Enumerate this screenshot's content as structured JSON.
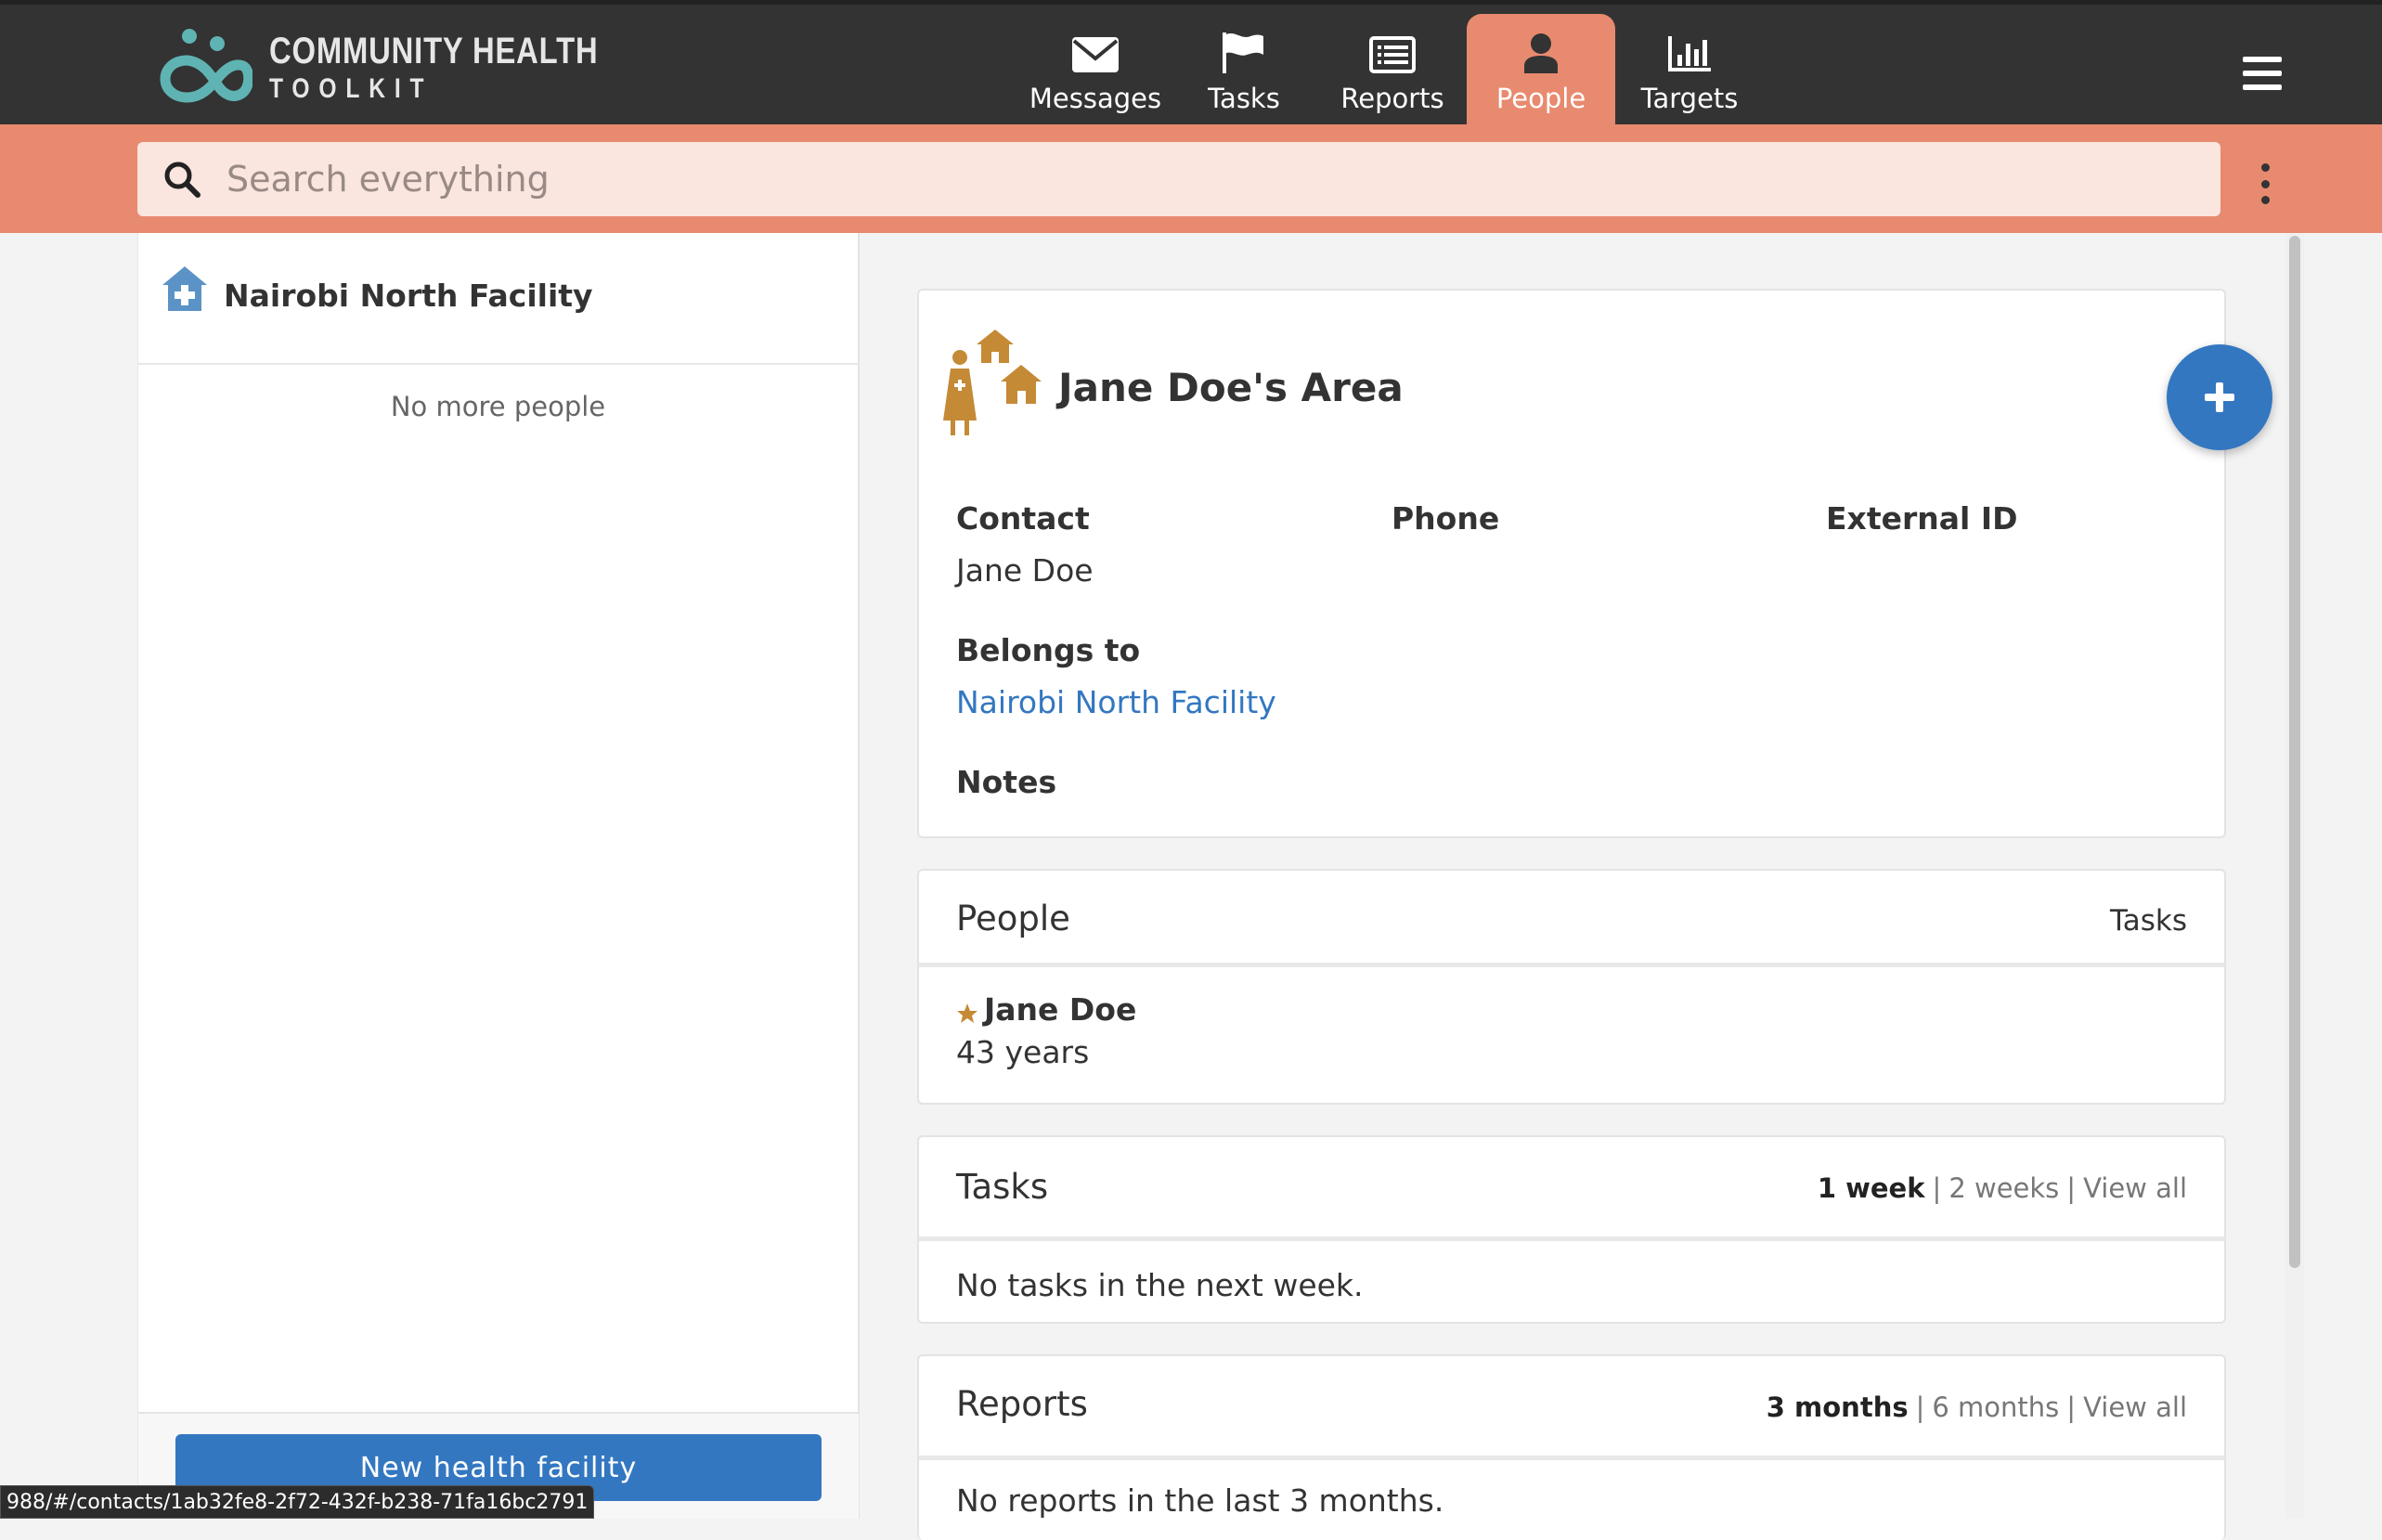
{
  "app": {
    "logo_line1": "COMMUNITY HEALTH",
    "logo_line2": "TOOLKIT"
  },
  "nav": {
    "items": [
      {
        "label": "Messages",
        "icon": "envelope-icon"
      },
      {
        "label": "Tasks",
        "icon": "flag-icon"
      },
      {
        "label": "Reports",
        "icon": "list-icon"
      },
      {
        "label": "People",
        "icon": "person-icon",
        "active": true
      },
      {
        "label": "Targets",
        "icon": "bar-chart-icon"
      }
    ]
  },
  "search": {
    "placeholder": "Search everything"
  },
  "left": {
    "facility_name": "Nairobi North Facility",
    "no_more": "No more people",
    "new_button": "New health facility"
  },
  "area": {
    "title": "Jane Doe's Area",
    "contact_label": "Contact",
    "contact_value": "Jane Doe",
    "phone_label": "Phone",
    "external_id_label": "External ID",
    "belongs_label": "Belongs to",
    "belongs_value": "Nairobi North Facility",
    "notes_label": "Notes"
  },
  "people": {
    "title": "People",
    "right": "Tasks",
    "person_name": "Jane Doe",
    "person_age": "43 years"
  },
  "tasks": {
    "title": "Tasks",
    "filter_active": "1 week",
    "filter_2": "2 weeks",
    "filter_all": "View all",
    "empty": "No tasks in the next week."
  },
  "reports": {
    "title": "Reports",
    "filter_active": "3 months",
    "filter_2": "6 months",
    "filter_all": "View all",
    "empty": "No reports in the last 3 months."
  },
  "status": {
    "url": "988/#/contacts/1ab32fe8-2f72-432f-b238-71fa16bc2791"
  },
  "colors": {
    "header": "#333333",
    "accent": "#e88a6f",
    "primary": "#3377c1",
    "place_icon": "#c48a36"
  }
}
